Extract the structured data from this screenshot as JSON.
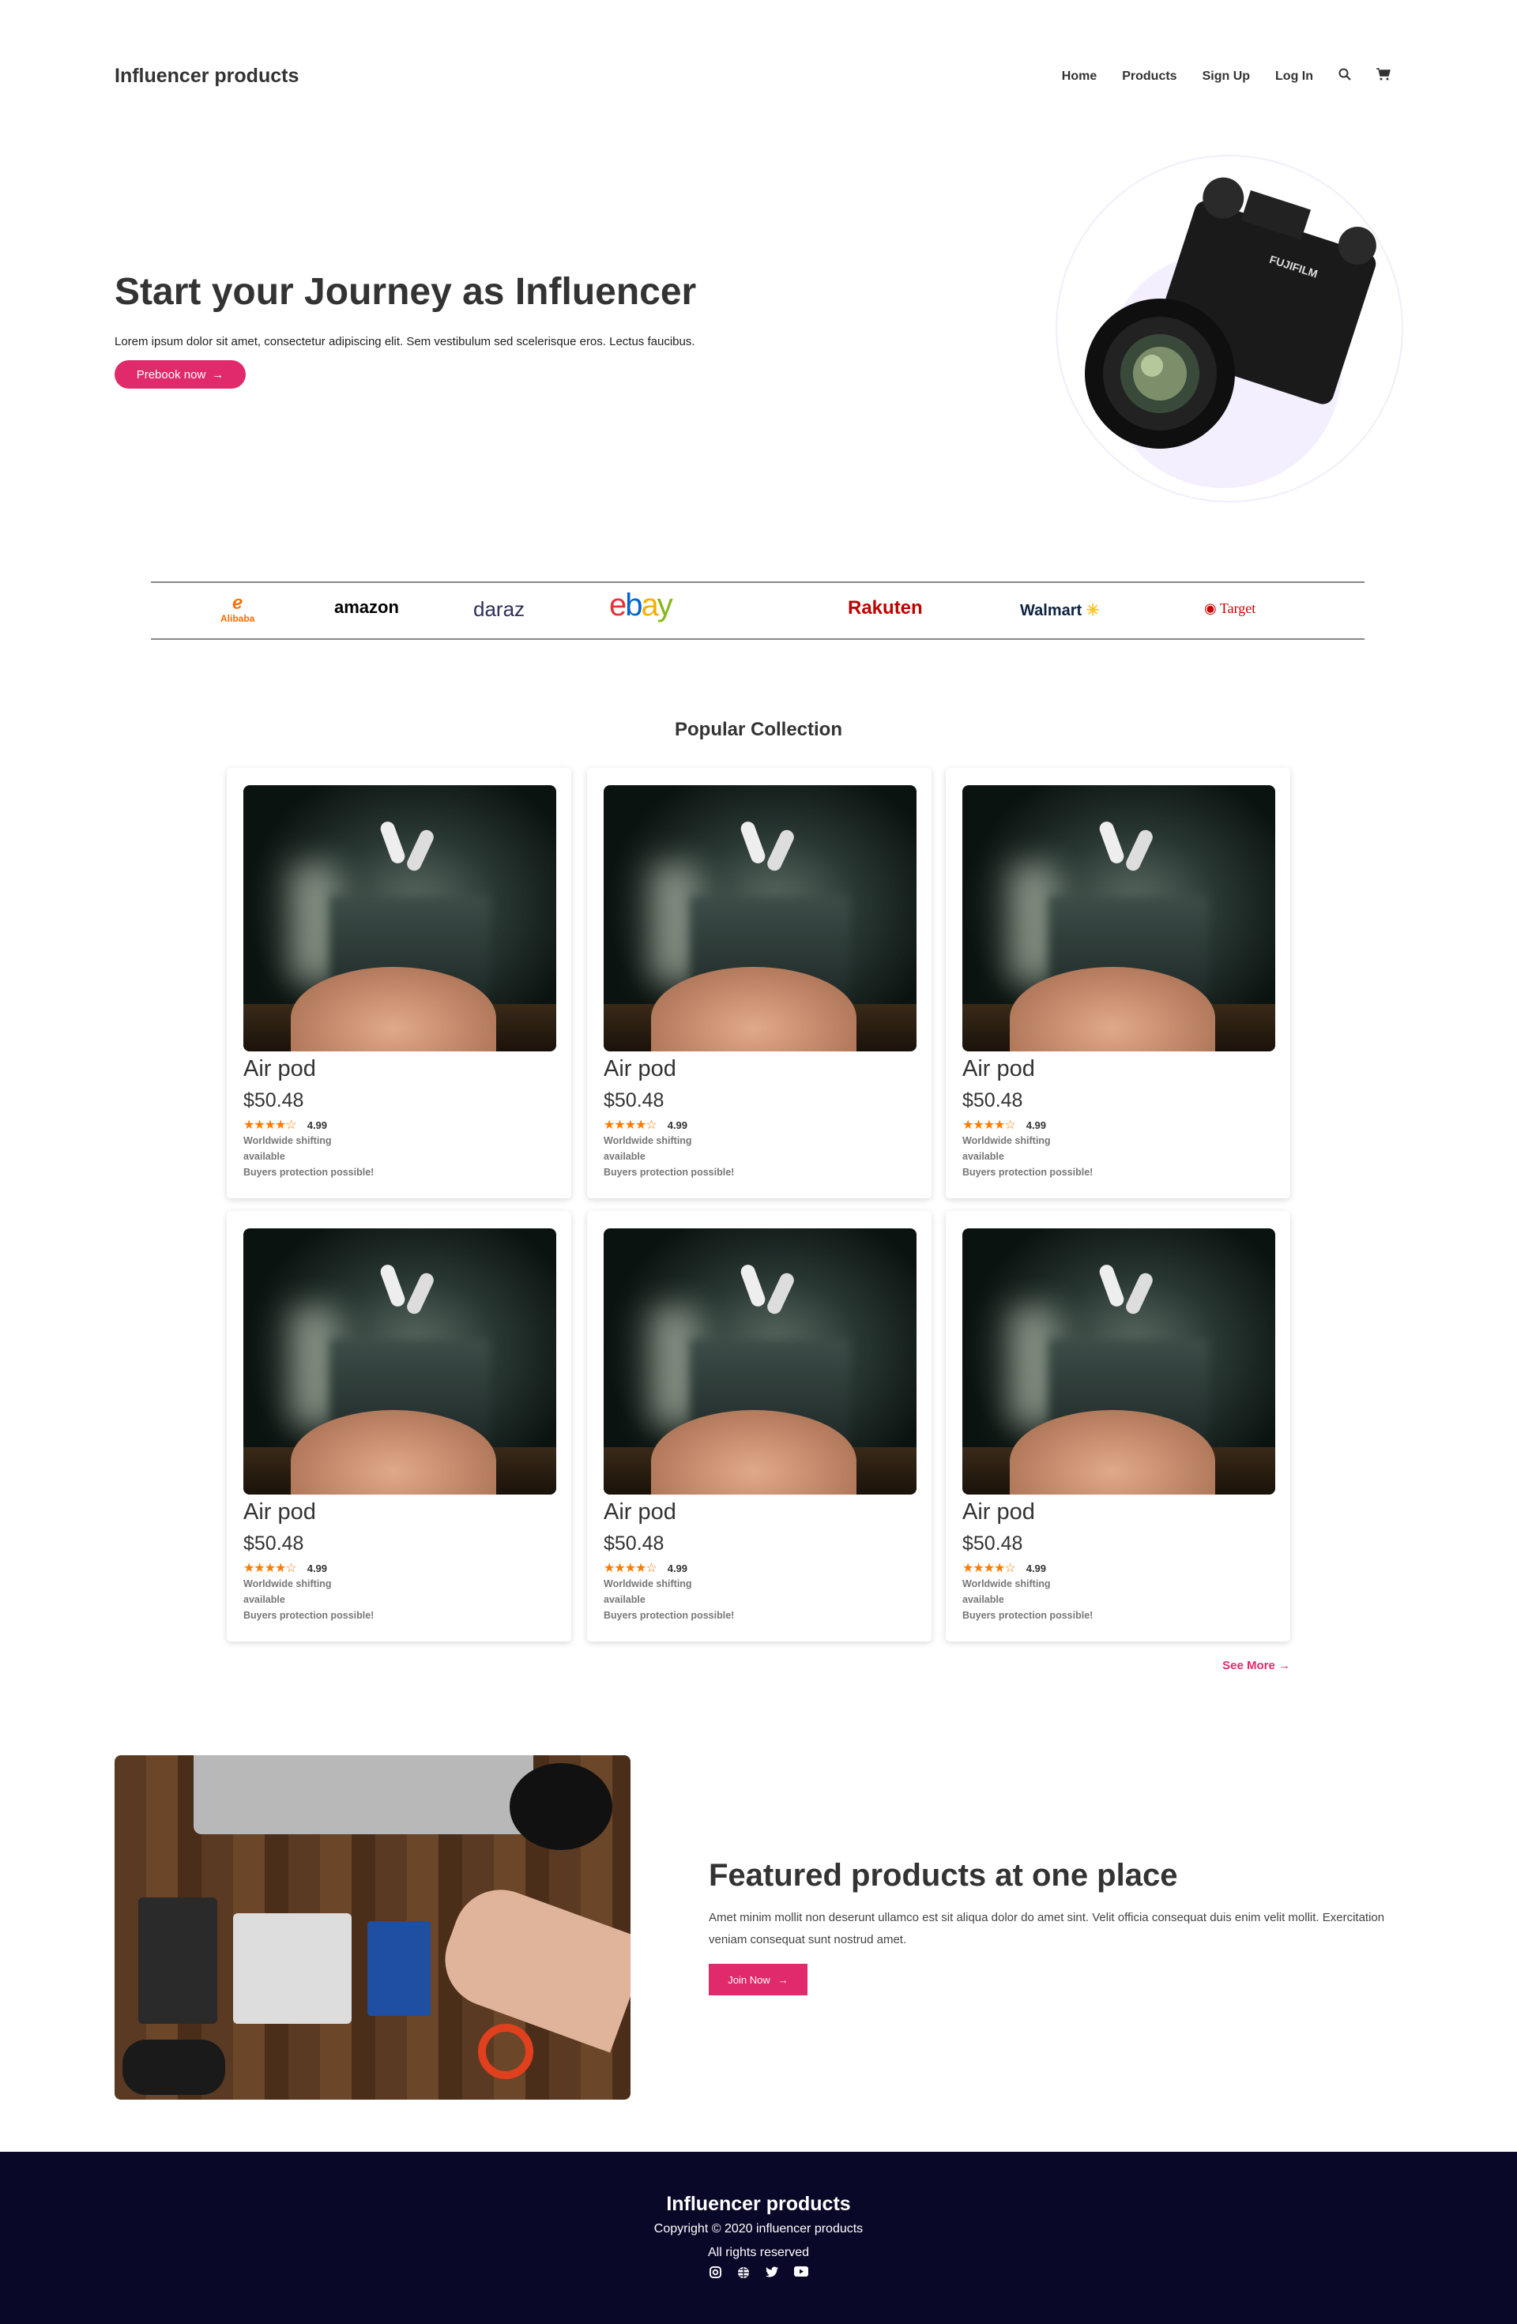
{
  "header": {
    "logo": "Influencer products",
    "nav": [
      "Home",
      "Products",
      "Sign Up",
      "Log In"
    ]
  },
  "hero": {
    "title": "Start your Journey as Influencer",
    "text": "Lorem ipsum dolor sit amet, consectetur adipiscing elit. Sem vestibulum sed scelerisque eros. Lectus faucibus.",
    "button": "Prebook now",
    "camera_brand": "FUJIFILM"
  },
  "brands": [
    "Alibaba",
    "amazon",
    "daraz",
    "ebay",
    "Rakuten",
    "Walmart",
    "Target"
  ],
  "collection": {
    "title": "Popular Collection",
    "see_more": "See More",
    "products": [
      {
        "name": "Air pod",
        "price": "$50.48",
        "rating": "4.99",
        "line1": "Worldwide shifting",
        "line2": "available",
        "line3": "Buyers protection possible!"
      },
      {
        "name": "Air pod",
        "price": "$50.48",
        "rating": "4.99",
        "line1": "Worldwide shifting",
        "line2": "available",
        "line3": "Buyers protection possible!"
      },
      {
        "name": "Air pod",
        "price": "$50.48",
        "rating": "4.99",
        "line1": "Worldwide shifting",
        "line2": "available",
        "line3": "Buyers protection possible!"
      },
      {
        "name": "Air pod",
        "price": "$50.48",
        "rating": "4.99",
        "line1": "Worldwide shifting",
        "line2": "available",
        "line3": "Buyers protection possible!"
      },
      {
        "name": "Air pod",
        "price": "$50.48",
        "rating": "4.99",
        "line1": "Worldwide shifting",
        "line2": "available",
        "line3": "Buyers protection possible!"
      },
      {
        "name": "Air pod",
        "price": "$50.48",
        "rating": "4.99",
        "line1": "Worldwide shifting",
        "line2": "available",
        "line3": "Buyers protection possible!"
      }
    ]
  },
  "featured": {
    "title": "Featured products at one place",
    "text": "Amet minim mollit non deserunt ullamco est sit aliqua dolor do amet sint. Velit officia consequat duis enim velit mollit. Exercitation veniam consequat sunt nostrud amet.",
    "button": "Join Now"
  },
  "footer": {
    "title": "Influencer products",
    "copyright": "Copyright © 2020 influencer products",
    "rights": "All rights reserved"
  },
  "colors": {
    "accent": "#e02a6b",
    "footer_bg": "#0a0828",
    "star": "#ff7a00"
  }
}
